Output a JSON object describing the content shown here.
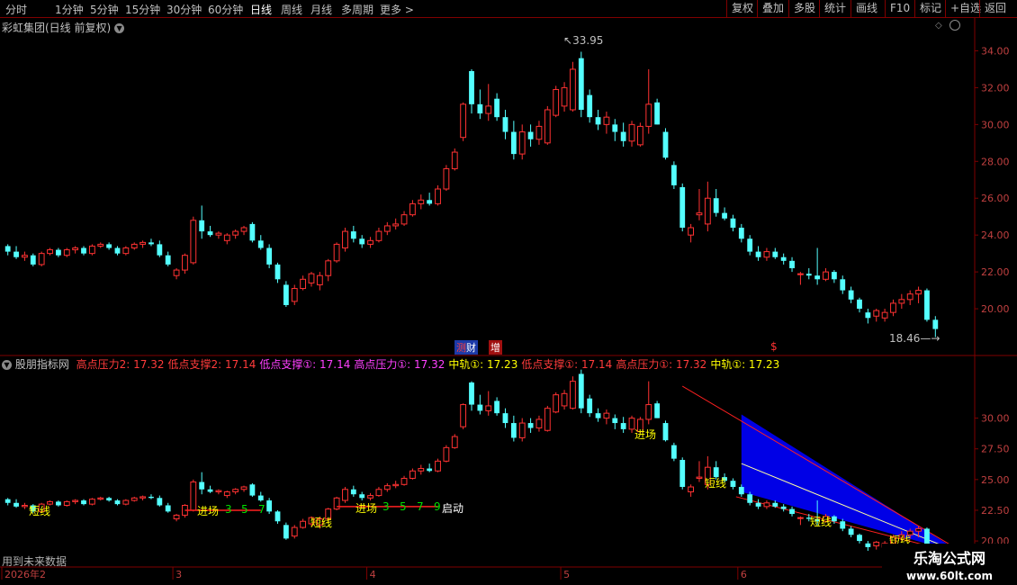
{
  "toolbar": {
    "periods": [
      "分时",
      "1分钟",
      "5分钟",
      "15分钟",
      "30分钟",
      "60分钟",
      "日线",
      "周线",
      "月线",
      "多周期",
      "更多"
    ],
    "active_period": "日线",
    "right_buttons": [
      "复权",
      "叠加",
      "多股",
      "统计",
      "画线",
      "F10",
      "标记",
      "+自选",
      "返回"
    ]
  },
  "stock_title": "彩虹集团(日线 前复权)",
  "price_annotations": {
    "high": "33.95",
    "low": "18.46"
  },
  "badges": {
    "finance": "财",
    "finance_prefix": "测",
    "increase": "增",
    "dollar": "$"
  },
  "indicator": {
    "name": "股朋指标网",
    "items": [
      {
        "label": "高点压力2:",
        "value": "17.32",
        "color": "#ff3b3b"
      },
      {
        "label": "低点支撑2:",
        "value": "17.14",
        "color": "#ff3b3b"
      },
      {
        "label": "低点支撑①:",
        "value": "17.14",
        "color": "#ff40ff"
      },
      {
        "label": "高点压力①:",
        "value": "17.32",
        "color": "#ff40ff"
      },
      {
        "label": "中轨①:",
        "value": "17.23",
        "color": "#ffff00"
      },
      {
        "label": "低点支撑①:",
        "value": "17.14",
        "color": "#ff3b3b"
      },
      {
        "label": "高点压力①:",
        "value": "17.32",
        "color": "#ff3b3b"
      },
      {
        "label": "中轨①:",
        "value": "17.23",
        "color": "#ffff00"
      }
    ]
  },
  "lower_labels": {
    "short": "短线",
    "enter": "进场",
    "start": "启动",
    "seq": [
      "3",
      "5",
      "7",
      "9"
    ]
  },
  "future_note": "用到未来数据",
  "watermark": {
    "title": "乐淘公式网",
    "url": "www.60lt.com"
  },
  "colors": {
    "up": "#ff3232",
    "down": "#54ffff",
    "axis": "#800000",
    "channel": "#0000ff"
  },
  "chart_data": [
    {
      "type": "candlestick",
      "title": "彩虹集团(日线 前复权)",
      "y_ticks": [
        20.0,
        22.0,
        24.0,
        26.0,
        28.0,
        30.0,
        32.0,
        34.0
      ],
      "ylim": [
        18.0,
        35.0
      ],
      "x_month_labels": [
        "2026年2",
        "3",
        "4",
        "5",
        "6"
      ],
      "max_annotation": 33.95,
      "min_annotation": 18.46,
      "candles": [
        [
          23.4,
          23.5,
          22.9,
          23.1
        ],
        [
          23.1,
          23.4,
          22.7,
          22.8
        ],
        [
          22.8,
          23.1,
          22.6,
          22.9
        ],
        [
          22.9,
          23.0,
          22.3,
          22.4
        ],
        [
          22.4,
          23.1,
          22.3,
          23.0
        ],
        [
          23.0,
          23.3,
          22.9,
          23.2
        ],
        [
          23.2,
          23.3,
          22.8,
          22.9
        ],
        [
          22.9,
          23.3,
          22.8,
          23.2
        ],
        [
          23.2,
          23.4,
          23.0,
          23.3
        ],
        [
          23.3,
          23.4,
          22.9,
          23.0
        ],
        [
          23.0,
          23.5,
          22.9,
          23.4
        ],
        [
          23.4,
          23.6,
          23.3,
          23.5
        ],
        [
          23.5,
          23.6,
          23.2,
          23.3
        ],
        [
          23.3,
          23.4,
          22.9,
          23.0
        ],
        [
          23.0,
          23.4,
          22.9,
          23.3
        ],
        [
          23.3,
          23.6,
          23.2,
          23.5
        ],
        [
          23.5,
          23.7,
          23.3,
          23.6
        ],
        [
          23.6,
          23.8,
          23.4,
          23.5
        ],
        [
          23.5,
          23.7,
          22.8,
          22.9
        ],
        [
          22.9,
          23.1,
          22.3,
          22.4
        ],
        [
          21.8,
          22.2,
          21.6,
          22.1
        ],
        [
          22.1,
          23.0,
          21.9,
          22.9
        ],
        [
          22.5,
          25.0,
          22.4,
          24.8
        ],
        [
          24.8,
          25.6,
          23.8,
          24.2
        ],
        [
          24.2,
          24.5,
          23.9,
          24.0
        ],
        [
          24.0,
          24.2,
          23.8,
          24.1
        ],
        [
          23.7,
          24.1,
          23.5,
          24.0
        ],
        [
          24.0,
          24.3,
          23.8,
          24.2
        ],
        [
          24.2,
          24.5,
          24.0,
          24.4
        ],
        [
          24.6,
          24.7,
          23.6,
          23.7
        ],
        [
          23.7,
          24.0,
          23.2,
          23.3
        ],
        [
          23.3,
          23.5,
          22.2,
          22.4
        ],
        [
          22.4,
          22.5,
          21.4,
          21.6
        ],
        [
          21.3,
          21.5,
          20.1,
          20.2
        ],
        [
          20.4,
          21.3,
          20.2,
          21.1
        ],
        [
          21.1,
          21.8,
          21.0,
          21.6
        ],
        [
          21.4,
          22.0,
          21.2,
          21.9
        ],
        [
          21.3,
          22.0,
          21.0,
          21.8
        ],
        [
          21.8,
          22.7,
          21.5,
          22.6
        ],
        [
          22.6,
          23.6,
          22.5,
          23.5
        ],
        [
          23.3,
          24.4,
          23.1,
          24.2
        ],
        [
          24.2,
          24.5,
          23.6,
          23.8
        ],
        [
          23.8,
          24.0,
          23.3,
          23.5
        ],
        [
          23.5,
          23.9,
          23.3,
          23.7
        ],
        [
          23.7,
          24.4,
          23.6,
          24.2
        ],
        [
          24.2,
          24.7,
          24.0,
          24.5
        ],
        [
          24.5,
          24.9,
          24.3,
          24.6
        ],
        [
          24.6,
          25.3,
          24.5,
          25.1
        ],
        [
          25.1,
          25.9,
          25.0,
          25.7
        ],
        [
          25.7,
          26.2,
          25.4,
          25.9
        ],
        [
          25.9,
          26.3,
          25.6,
          25.7
        ],
        [
          25.7,
          26.7,
          25.6,
          26.5
        ],
        [
          26.5,
          27.8,
          26.4,
          27.6
        ],
        [
          27.6,
          28.7,
          27.5,
          28.5
        ],
        [
          29.3,
          31.2,
          29.1,
          31.1
        ],
        [
          32.9,
          33.0,
          30.6,
          31.1
        ],
        [
          31.1,
          31.9,
          30.3,
          30.6
        ],
        [
          30.6,
          32.2,
          30.2,
          31.0
        ],
        [
          31.4,
          31.7,
          30.2,
          30.4
        ],
        [
          30.4,
          30.8,
          29.2,
          29.6
        ],
        [
          29.6,
          30.2,
          28.1,
          28.4
        ],
        [
          28.4,
          30.0,
          28.1,
          29.6
        ],
        [
          29.6,
          30.0,
          28.8,
          29.2
        ],
        [
          29.2,
          30.2,
          28.9,
          29.9
        ],
        [
          29.0,
          31.0,
          28.9,
          30.8
        ],
        [
          30.5,
          32.1,
          30.4,
          31.9
        ],
        [
          31.0,
          32.3,
          30.7,
          32.0
        ],
        [
          30.8,
          33.4,
          30.7,
          33.0
        ],
        [
          33.6,
          33.95,
          30.4,
          30.8
        ],
        [
          31.6,
          31.9,
          30.1,
          30.4
        ],
        [
          30.4,
          30.8,
          29.7,
          30.0
        ],
        [
          30.0,
          30.7,
          29.5,
          30.4
        ],
        [
          30.0,
          30.3,
          29.1,
          29.6
        ],
        [
          29.6,
          30.1,
          28.8,
          29.1
        ],
        [
          29.1,
          30.2,
          28.8,
          30.0
        ],
        [
          28.9,
          30.1,
          28.8,
          29.9
        ],
        [
          29.9,
          33.0,
          29.5,
          31.1
        ],
        [
          31.2,
          31.4,
          30.0,
          30.0
        ],
        [
          29.6,
          29.8,
          28.1,
          28.2
        ],
        [
          27.8,
          28.0,
          26.5,
          26.7
        ],
        [
          26.6,
          26.8,
          24.2,
          24.4
        ],
        [
          24.0,
          24.6,
          23.6,
          24.4
        ],
        [
          25.1,
          26.5,
          24.8,
          25.2
        ],
        [
          24.6,
          26.9,
          24.2,
          26.0
        ],
        [
          26.0,
          26.5,
          25.0,
          25.2
        ],
        [
          25.2,
          25.5,
          24.8,
          24.9
        ],
        [
          24.9,
          25.1,
          24.2,
          24.4
        ],
        [
          24.4,
          24.6,
          23.6,
          23.8
        ],
        [
          23.8,
          24.0,
          22.9,
          23.1
        ],
        [
          23.1,
          23.4,
          22.6,
          22.8
        ],
        [
          22.8,
          23.3,
          22.6,
          23.1
        ],
        [
          23.1,
          23.3,
          22.7,
          22.8
        ],
        [
          22.8,
          23.0,
          22.4,
          22.6
        ],
        [
          22.6,
          22.8,
          22.0,
          22.2
        ],
        [
          21.9,
          22.0,
          21.3,
          21.9
        ],
        [
          21.9,
          22.2,
          21.6,
          21.8
        ],
        [
          21.8,
          23.3,
          21.3,
          21.6
        ],
        [
          21.6,
          22.2,
          21.5,
          22.0
        ],
        [
          22.0,
          22.1,
          21.4,
          21.6
        ],
        [
          21.6,
          21.8,
          20.8,
          21.0
        ],
        [
          21.0,
          21.2,
          20.3,
          20.5
        ],
        [
          20.5,
          20.6,
          19.8,
          20.0
        ],
        [
          19.8,
          20.0,
          19.2,
          19.5
        ],
        [
          19.6,
          20.0,
          19.3,
          19.9
        ],
        [
          19.5,
          20.0,
          19.3,
          19.8
        ],
        [
          19.8,
          20.5,
          19.6,
          20.3
        ],
        [
          20.3,
          20.8,
          20.0,
          20.5
        ],
        [
          20.5,
          21.0,
          20.2,
          20.8
        ],
        [
          20.8,
          21.2,
          20.3,
          21.0
        ],
        [
          21.0,
          21.1,
          19.3,
          19.4
        ],
        [
          19.4,
          19.6,
          18.46,
          18.9
        ]
      ]
    },
    {
      "type": "candlestick",
      "title": "股朋指标网",
      "y_ticks": [
        20.0,
        22.5,
        25.0,
        27.5,
        30.0
      ],
      "ylim": [
        19.2,
        34.0
      ]
    }
  ]
}
